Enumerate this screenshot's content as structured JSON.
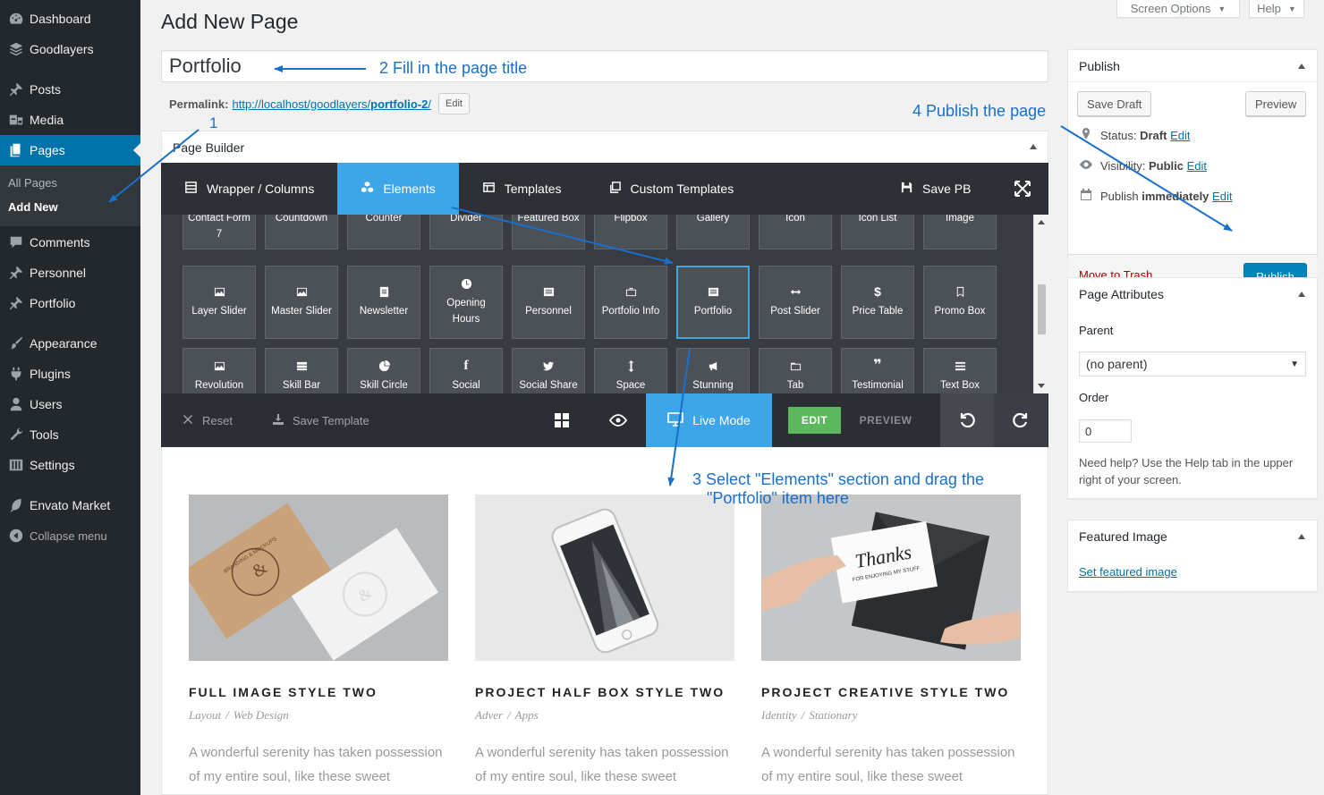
{
  "sidebar": {
    "items": [
      {
        "label": "Dashboard",
        "icon": "dashboard-icon"
      },
      {
        "label": "Goodlayers",
        "icon": "layers-icon"
      },
      {
        "label": "Posts",
        "icon": "pin-icon"
      },
      {
        "label": "Media",
        "icon": "media-icon"
      },
      {
        "label": "Pages",
        "icon": "pages-icon"
      },
      {
        "label": "Comments",
        "icon": "comment-icon"
      },
      {
        "label": "Personnel",
        "icon": "pin-icon"
      },
      {
        "label": "Portfolio",
        "icon": "pin-icon"
      },
      {
        "label": "Appearance",
        "icon": "brush-icon"
      },
      {
        "label": "Plugins",
        "icon": "plug-icon"
      },
      {
        "label": "Users",
        "icon": "user-icon"
      },
      {
        "label": "Tools",
        "icon": "wrench-icon"
      },
      {
        "label": "Settings",
        "icon": "sliders-icon"
      },
      {
        "label": "Envato Market",
        "icon": "leaf-icon"
      }
    ],
    "submenu": [
      "All Pages",
      "Add New"
    ],
    "collapse": "Collapse menu"
  },
  "top": {
    "screen_options": "Screen Options",
    "help": "Help"
  },
  "page_title": "Add New Page",
  "title_value": "Portfolio",
  "permalink": {
    "label": "Permalink:",
    "url_prefix": "http://localhost/goodlayers/",
    "slug": "portfolio-2",
    "url_suffix": "/",
    "edit": "Edit"
  },
  "page_builder": {
    "heading": "Page Builder",
    "tabs": [
      "Wrapper / Columns",
      "Elements",
      "Templates",
      "Custom Templates"
    ],
    "save_pb": "Save PB",
    "row1": [
      "Contact Form 7",
      "Countdown",
      "Counter",
      "Divider",
      "Featured Box",
      "Flipbox",
      "Gallery",
      "Icon",
      "Icon List",
      "Image"
    ],
    "row2": [
      "Layer Slider",
      "Master Slider",
      "Newsletter",
      "Opening Hours",
      "Personnel",
      "Portfolio Info",
      "Portfolio",
      "Post Slider",
      "Price Table",
      "Promo Box"
    ],
    "row3": [
      "Revolution",
      "Skill Bar",
      "Skill Circle",
      "Social",
      "Social Share",
      "Space",
      "Stunning",
      "Tab",
      "Testimonial",
      "Text Box"
    ],
    "bottom": {
      "reset": "Reset",
      "save_template": "Save Template",
      "live_mode": "Live Mode",
      "edit": "EDIT",
      "preview": "PREVIEW"
    }
  },
  "portfolio": [
    {
      "title": "FULL IMAGE STYLE TWO",
      "cat1": "Layout",
      "cat2": "Web Design",
      "desc": "A wonderful serenity has taken possession of my entire soul, like these sweet"
    },
    {
      "title": "PROJECT HALF BOX STYLE TWO",
      "cat1": "Adver",
      "cat2": "Apps",
      "desc": "A wonderful serenity has taken possession of my entire soul, like these sweet"
    },
    {
      "title": "PROJECT CREATIVE STYLE TWO",
      "cat1": "Identity",
      "cat2": "Stationary",
      "desc": "A wonderful serenity has taken possession of my entire soul, like these sweet"
    }
  ],
  "image_texts": {
    "card_brand": "BRANDING & MOCKUPS",
    "thanks": "Thanks",
    "thanks_sub": "FOR ENJOYING MY STUFF"
  },
  "publish": {
    "heading": "Publish",
    "save_draft": "Save Draft",
    "preview": "Preview",
    "status_label": "Status:",
    "status_value": "Draft",
    "visibility_label": "Visibility:",
    "visibility_value": "Public",
    "publish_label": "Publish",
    "publish_value": "immediately",
    "edit": "Edit",
    "trash": "Move to Trash",
    "publish_btn": "Publish"
  },
  "page_attributes": {
    "heading": "Page Attributes",
    "parent_label": "Parent",
    "parent_value": "(no parent)",
    "order_label": "Order",
    "order_value": "0",
    "help": "Need help? Use the Help tab in the upper right of your screen."
  },
  "featured_image": {
    "heading": "Featured Image",
    "link": "Set featured image"
  },
  "annotations": {
    "a1": "1",
    "a2": "2 Fill in the page title",
    "a3_line1": "3 Select \"Elements\" section and drag the",
    "a3_line2": "\"Portfolio\" item here",
    "a4": "4 Publish the page"
  },
  "colors": {
    "accent": "#0073aa",
    "builder_blue": "#3da6e8",
    "annotation": "#1a6fc9",
    "edit_green": "#5cb85c",
    "admin_dark": "#23282d"
  }
}
